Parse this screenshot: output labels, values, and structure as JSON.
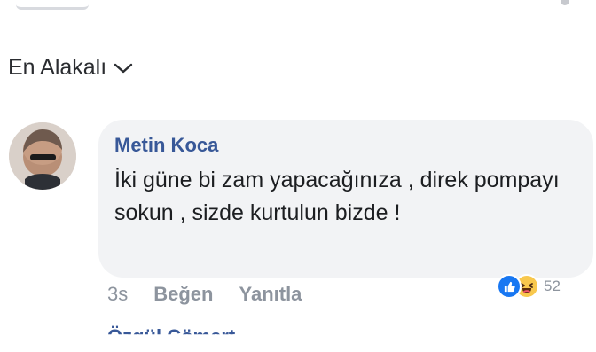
{
  "sort": {
    "label": "En Alakalı"
  },
  "comment": {
    "author": "Metin Koca",
    "text": "İki güne bi zam yapacağınıza , direk pompayı sokun , sizde kurtulun bizde !",
    "time": "3s",
    "like_label": "Beğen",
    "reply_label": "Yanıtla",
    "reactions": {
      "icons": [
        "like-icon",
        "haha-icon"
      ],
      "count": "52"
    }
  },
  "next_comment": {
    "author_partial": "Özgül Cömert"
  },
  "colors": {
    "author_link": "#385898",
    "bubble_bg": "#f2f3f5",
    "meta_text": "#8d949e",
    "like_blue": "#1877f2",
    "haha_yellow": "#f8c84d"
  }
}
